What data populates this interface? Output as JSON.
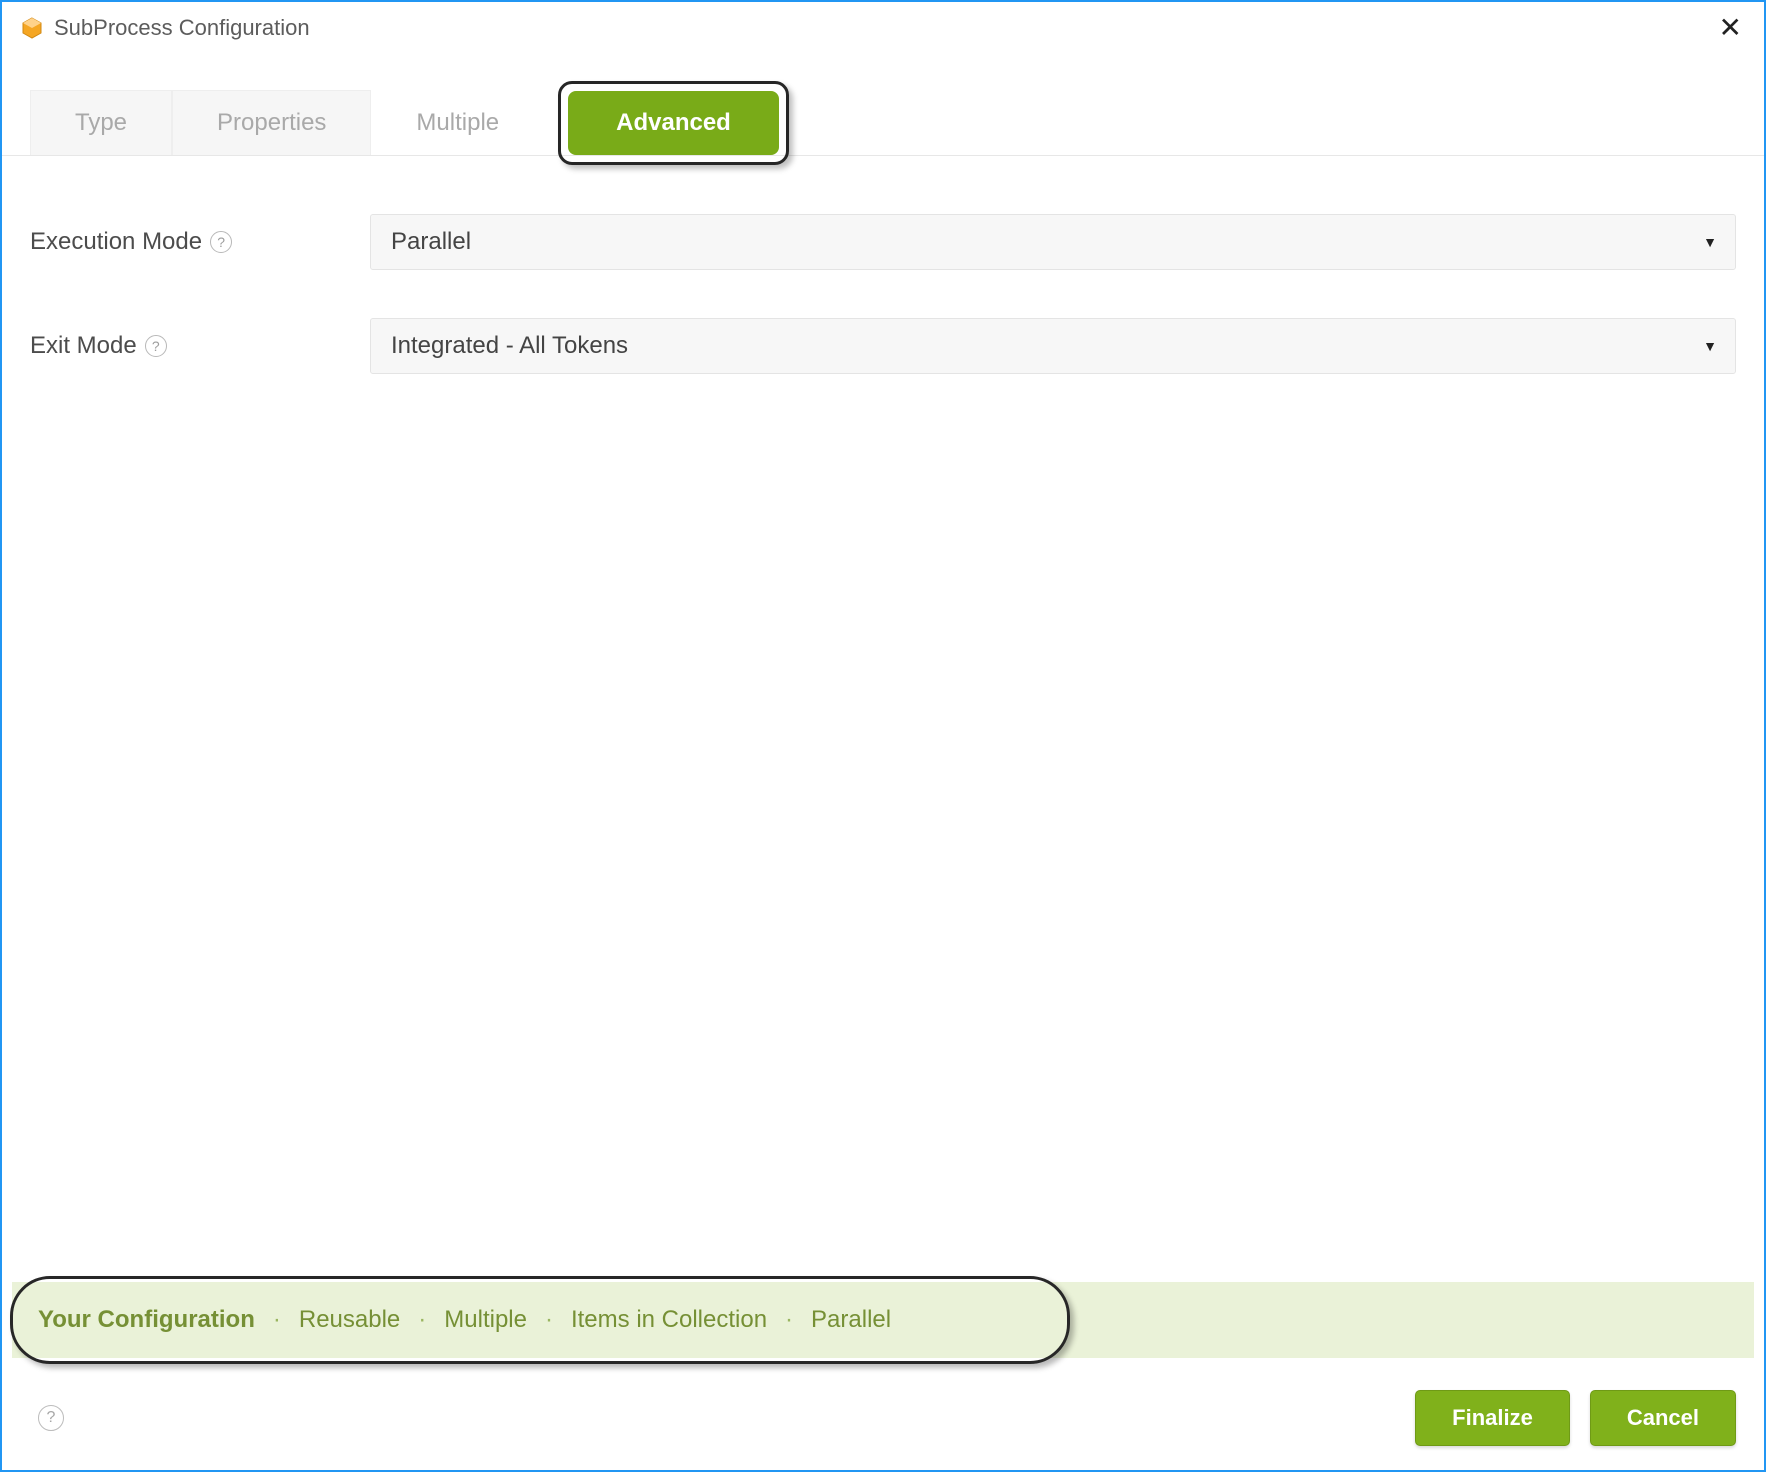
{
  "window": {
    "title": "SubProcess Configuration"
  },
  "tabs": {
    "type": "Type",
    "properties": "Properties",
    "multiple": "Multiple",
    "advanced": "Advanced"
  },
  "form": {
    "execution_mode": {
      "label": "Execution Mode",
      "value": "Parallel"
    },
    "exit_mode": {
      "label": "Exit Mode",
      "value": "Integrated - All Tokens"
    }
  },
  "config_summary": {
    "heading": "Your Configuration",
    "items": [
      "Reusable",
      "Multiple",
      "Items in Collection",
      "Parallel"
    ]
  },
  "footer": {
    "finalize": "Finalize",
    "cancel": "Cancel"
  }
}
